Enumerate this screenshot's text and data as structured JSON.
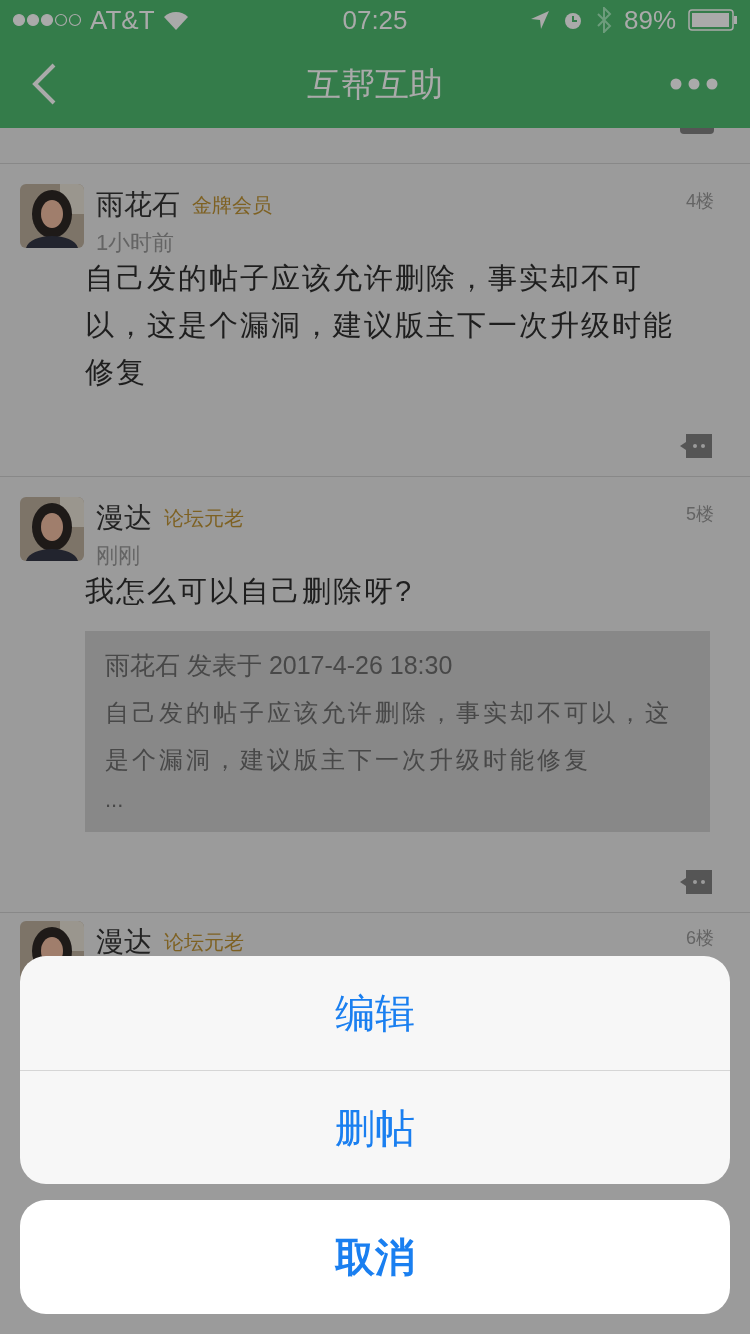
{
  "status_bar": {
    "carrier": "AT&T",
    "time": "07:25",
    "battery": "89%"
  },
  "nav": {
    "title": "互帮互助"
  },
  "posts": [
    {
      "kind": "full",
      "author": "雨花石",
      "badge": "金牌会员",
      "time": "1小时前",
      "floor": "4楼",
      "body": "自己发的帖子应该允许删除，事实却不可以，这是个漏洞，建议版主下一次升级时能修复"
    },
    {
      "kind": "full",
      "author": "漫达",
      "badge": "论坛元老",
      "time": "刚刚",
      "floor": "5楼",
      "body": "我怎么可以自己删除呀?",
      "quote": {
        "header": "雨花石 发表于 2017-4-26 18:30",
        "body": "自己发的帖子应该允许删除，事实却不可以，这是个漏洞，建议版主下一次升级时能修复",
        "ellipsis": "..."
      }
    },
    {
      "kind": "partial",
      "author": "漫达",
      "badge": "论坛元老",
      "floor": "6楼"
    }
  ],
  "action_sheet": {
    "actions": [
      "编辑",
      "删帖"
    ],
    "cancel": "取消"
  }
}
